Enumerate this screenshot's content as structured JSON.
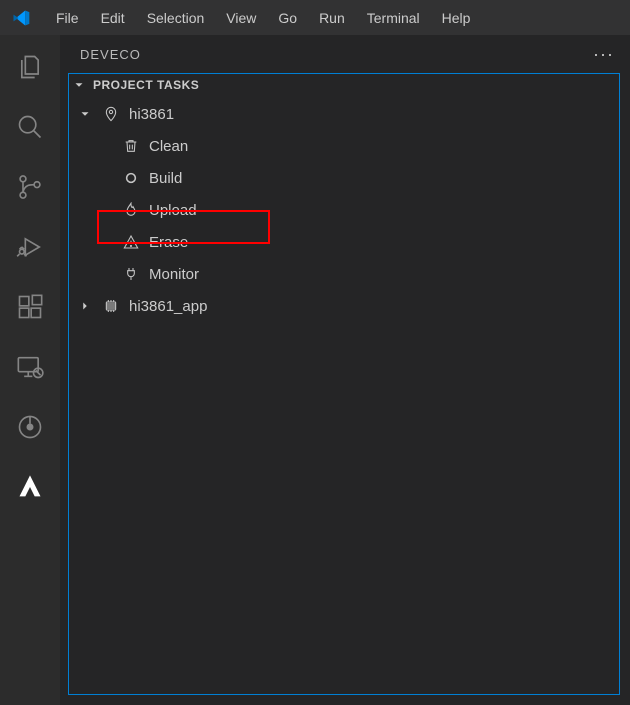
{
  "menu": {
    "file": "File",
    "edit": "Edit",
    "selection": "Selection",
    "view": "View",
    "go": "Go",
    "run": "Run",
    "terminal": "Terminal",
    "help": "Help"
  },
  "sidebar": {
    "title": "DEVECO",
    "panel_title": "PROJECT TASKS"
  },
  "tree": {
    "root": "hi3861",
    "clean": "Clean",
    "build": "Build",
    "upload": "Upload",
    "erase": "Erase",
    "monitor": "Monitor",
    "app": "hi3861_app"
  }
}
